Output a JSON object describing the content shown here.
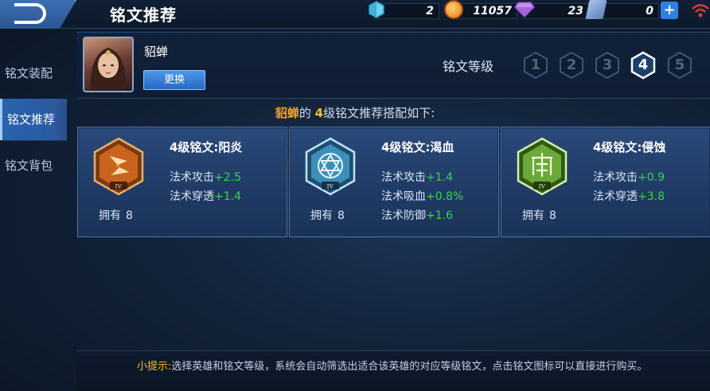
{
  "header": {
    "title": "铭文推荐",
    "resources": {
      "gems": "2",
      "coins": "11057",
      "diamonds": "23",
      "vouchers": "0"
    },
    "plus_label": "+"
  },
  "sidebar": {
    "items": [
      {
        "label": "铭文装配",
        "active": false
      },
      {
        "label": "铭文推荐",
        "active": true
      },
      {
        "label": "铭文背包",
        "active": false
      }
    ]
  },
  "hero": {
    "name": "貂蝉",
    "swap_label": "更换"
  },
  "rune_level": {
    "label": "铭文等级",
    "levels": [
      "1",
      "2",
      "3",
      "4",
      "5"
    ],
    "selected": "4"
  },
  "headline": {
    "hero": "貂蝉",
    "middle": "的 ",
    "level": "4",
    "rest": "级铭文推荐搭配如下:"
  },
  "cards": [
    {
      "title": "4级铭文:阳炎",
      "own_label": "拥有",
      "own_count": "8",
      "stats": [
        {
          "name": "法术攻击",
          "value": "+2.5"
        },
        {
          "name": "法术穿透",
          "value": "+1.4"
        }
      ],
      "color": "#d4752a",
      "emblem_numeral": "IV"
    },
    {
      "title": "4级铭文:渴血",
      "own_label": "拥有",
      "own_count": "8",
      "stats": [
        {
          "name": "法术攻击",
          "value": "+1.4"
        },
        {
          "name": "法术吸血",
          "value": "+0.8%"
        },
        {
          "name": "法术防御",
          "value": "+1.6"
        }
      ],
      "color": "#3b8fb8",
      "emblem_numeral": "IV"
    },
    {
      "title": "4级铭文:侵蚀",
      "own_label": "拥有",
      "own_count": "8",
      "stats": [
        {
          "name": "法术攻击",
          "value": "+0.9"
        },
        {
          "name": "法术穿透",
          "value": "+3.8"
        }
      ],
      "color": "#6aa83a",
      "emblem_numeral": "IV"
    }
  ],
  "tip": {
    "label": "小提示:",
    "text": "选择英雄和铭文等级，系统会自动筛选出适合该英雄的对应等级铭文，点击铭文图标可以直接进行购买。"
  },
  "colors": {
    "accent": "#2b5aa0",
    "stat_bonus": "#34d54a",
    "highlight": "#f5a31a"
  }
}
